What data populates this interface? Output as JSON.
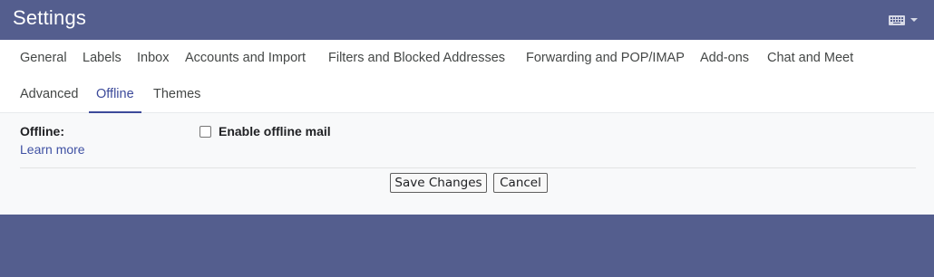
{
  "header": {
    "title": "Settings",
    "input_tools_icon": "keyboard-icon"
  },
  "tabs": [
    {
      "label": "General",
      "active": false
    },
    {
      "label": "Labels",
      "active": false
    },
    {
      "label": "Inbox",
      "active": false
    },
    {
      "label": "Accounts and Import",
      "active": false
    },
    {
      "label": "Filters and Blocked Addresses",
      "active": false
    },
    {
      "label": "Forwarding and POP/IMAP",
      "active": false
    },
    {
      "label": "Add-ons",
      "active": false
    },
    {
      "label": "Chat and Meet",
      "active": false
    },
    {
      "label": "Advanced",
      "active": false
    },
    {
      "label": "Offline",
      "active": true
    },
    {
      "label": "Themes",
      "active": false
    }
  ],
  "offline": {
    "label": "Offline:",
    "learn_more": "Learn more",
    "enable_label": "Enable offline mail",
    "enabled": false
  },
  "actions": {
    "save_label": "Save Changes",
    "cancel_label": "Cancel"
  },
  "colors": {
    "header_bg": "#545e8e",
    "accent": "#3c4a9a",
    "link": "#3f51a3"
  }
}
